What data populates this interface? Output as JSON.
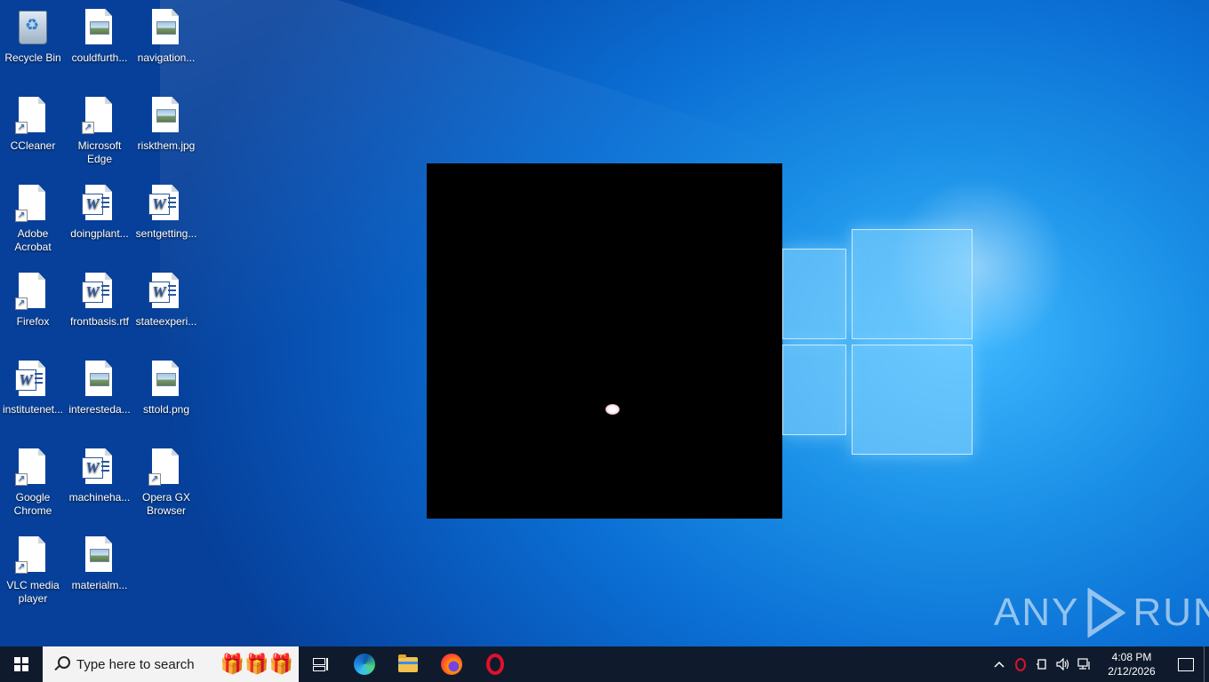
{
  "desktop": {
    "icons": [
      {
        "label": "Recycle Bin",
        "kind": "recycle-bin"
      },
      {
        "label": "couldfurth...",
        "kind": "image"
      },
      {
        "label": "navigation...",
        "kind": "image"
      },
      {
        "label": "CCleaner",
        "kind": "shortcut"
      },
      {
        "label": "Microsoft Edge",
        "kind": "shortcut"
      },
      {
        "label": "riskthem.jpg",
        "kind": "image"
      },
      {
        "label": "Adobe Acrobat",
        "kind": "shortcut"
      },
      {
        "label": "doingplant...",
        "kind": "word"
      },
      {
        "label": "sentgetting...",
        "kind": "word"
      },
      {
        "label": "Firefox",
        "kind": "shortcut"
      },
      {
        "label": "frontbasis.rtf",
        "kind": "word"
      },
      {
        "label": "stateexperi...",
        "kind": "word"
      },
      {
        "label": "institutenet...",
        "kind": "word"
      },
      {
        "label": "interesteda...",
        "kind": "image"
      },
      {
        "label": "sttold.png",
        "kind": "image"
      },
      {
        "label": "Google Chrome",
        "kind": "shortcut"
      },
      {
        "label": "machineha...",
        "kind": "word"
      },
      {
        "label": "Opera GX Browser",
        "kind": "shortcut"
      },
      {
        "label": "VLC media player",
        "kind": "shortcut"
      },
      {
        "label": "materialm...",
        "kind": "image"
      }
    ]
  },
  "watermark": {
    "left": "ANY",
    "right": "RUN"
  },
  "taskbar": {
    "search_placeholder": "Type here to search",
    "pinned": [
      "task-view",
      "microsoft-edge",
      "file-explorer",
      "firefox",
      "opera"
    ],
    "tray_chevron": "^",
    "clock": {
      "time": "4:08 PM",
      "date": "2/12/2026"
    }
  }
}
